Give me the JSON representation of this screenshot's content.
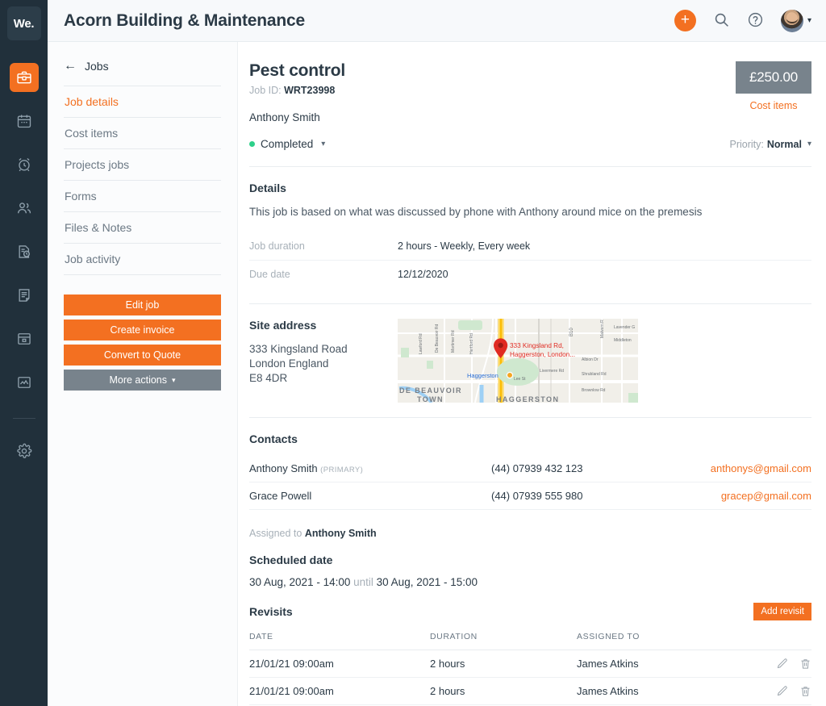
{
  "brand": {
    "logo_text": "We.",
    "accent": "#f37021",
    "rail_bg": "#21303b",
    "grey": "#78838c",
    "status_green": "#2ed08a"
  },
  "topbar": {
    "title": "Acorn Building & Maintenance",
    "add_label": "+",
    "icons": {
      "search": "search-icon",
      "help": "help-icon",
      "avatar": "avatar"
    }
  },
  "rail": {
    "items": [
      {
        "icon": "briefcase-icon",
        "active": true
      },
      {
        "icon": "calendar-icon",
        "active": false
      },
      {
        "icon": "alarm-clock-icon",
        "active": false
      },
      {
        "icon": "users-icon",
        "active": false
      },
      {
        "icon": "document-clock-icon",
        "active": false
      },
      {
        "icon": "notes-icon",
        "active": false
      },
      {
        "icon": "archive-box-icon",
        "active": false
      },
      {
        "icon": "chart-icon",
        "active": false
      },
      {
        "icon": "gear-icon",
        "active": false
      }
    ]
  },
  "leftpanel": {
    "back_label": "Jobs",
    "nav": [
      {
        "label": "Job details",
        "active": true
      },
      {
        "label": "Cost items",
        "active": false
      },
      {
        "label": "Projects jobs",
        "active": false
      },
      {
        "label": "Forms",
        "active": false
      },
      {
        "label": "Files & Notes",
        "active": false
      },
      {
        "label": "Job activity",
        "active": false
      }
    ],
    "actions": [
      {
        "label": "Edit job",
        "style": "orange"
      },
      {
        "label": "Create invoice",
        "style": "orange"
      },
      {
        "label": "Convert to Quote",
        "style": "orange"
      },
      {
        "label": "More actions",
        "style": "grey",
        "caret": true
      }
    ]
  },
  "job": {
    "title": "Pest control",
    "job_id_label": "Job ID:",
    "job_id_value": "WRT23998",
    "client": "Anthony Smith",
    "status": "Completed",
    "priority_label": "Priority:",
    "priority_value": "Normal",
    "price": "£250.00",
    "price_link": "Cost items"
  },
  "details": {
    "heading": "Details",
    "description": "This job is based on what was discussed by phone with Anthony around mice on the premesis",
    "fields": [
      {
        "key": "Job duration",
        "value": "2 hours - Weekly, Every week"
      },
      {
        "key": "Due date",
        "value": "12/12/2020"
      }
    ]
  },
  "site_address": {
    "heading": "Site address",
    "line1": "333 Kingsland Road",
    "line2": "London England",
    "line3": "E8 4DR",
    "map": {
      "pin_label": "333 Kingsland Rd, Haggerston, London...",
      "station": "Haggerston",
      "area_label_1": "DE BEAUVOIR",
      "area_label_2": "TOWN",
      "area_label_3": "HAGGERSTON",
      "streets": [
        "Lawford Rd",
        "De Beauvoir Rd",
        "Mortimer Rd",
        "Hertford Rd",
        "B10",
        "Malvern R",
        "Lavender G",
        "Middleton",
        "Albion Dr",
        "Shrubland Rd",
        "Livermere Rd",
        "Lee St",
        "Brownlow Rd"
      ]
    }
  },
  "contacts": {
    "heading": "Contacts",
    "rows": [
      {
        "name": "Anthony Smith",
        "tag": "(PRIMARY)",
        "phone": "(44) 07939 432 123",
        "email": "anthonys@gmail.com"
      },
      {
        "name": "Grace Powell",
        "tag": "",
        "phone": "(44) 07939 555 980",
        "email": "gracep@gmail.com"
      }
    ],
    "assigned_label": "Assigned to",
    "assigned_value": "Anthony Smith"
  },
  "scheduled": {
    "heading": "Scheduled date",
    "start": "30 Aug, 2021 - 14:00",
    "connector": "until",
    "end": "30 Aug, 2021 - 15:00"
  },
  "revisits": {
    "heading": "Revisits",
    "add_label": "Add revisit",
    "columns": [
      "DATE",
      "DURATION",
      "ASSIGNED TO"
    ],
    "rows": [
      {
        "date": "21/01/21 09:00am",
        "duration": "2 hours",
        "assigned": "James Atkins"
      },
      {
        "date": "21/01/21 09:00am",
        "duration": "2 hours",
        "assigned": "James Atkins"
      }
    ]
  }
}
